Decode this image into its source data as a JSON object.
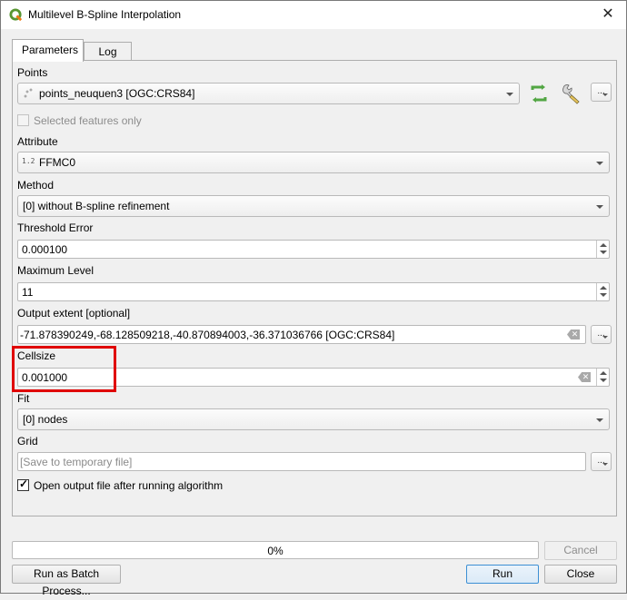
{
  "window": {
    "title": "Multilevel B-Spline Interpolation",
    "app_icon": "qgis-logo-icon",
    "close_icon": "close-icon"
  },
  "tabs": [
    {
      "label": "Parameters",
      "active": true
    },
    {
      "label": "Log",
      "active": false
    }
  ],
  "params": {
    "points": {
      "label": "Points",
      "value": "points_neuquen3 [OGC:CRS84]",
      "layer_icon": "point-layer-icon",
      "iterate_icon": "iterate-features-icon",
      "settings_icon": "wrench-icon",
      "browse_label": "..."
    },
    "selected_only": {
      "label": "Selected features only",
      "checked": false,
      "enabled": false
    },
    "attribute": {
      "label": "Attribute",
      "type_badge": "1.2",
      "value": "FFMC0"
    },
    "method": {
      "label": "Method",
      "value": "[0] without B-spline refinement"
    },
    "threshold": {
      "label": "Threshold Error",
      "value": "0.000100"
    },
    "max_level": {
      "label": "Maximum Level",
      "value": "11"
    },
    "extent": {
      "label": "Output extent [optional]",
      "value": "-71.878390249,-68.128509218,-40.870894003,-36.371036766 [OGC:CRS84]",
      "browse_label": "..."
    },
    "cellsize": {
      "label": "Cellsize",
      "value": "0.001000"
    },
    "fit": {
      "label": "Fit",
      "value": "[0] nodes"
    },
    "grid": {
      "label": "Grid",
      "placeholder": "[Save to temporary file]",
      "browse_label": "..."
    },
    "open_output": {
      "label": "Open output file after running algorithm",
      "checked": true
    }
  },
  "footer": {
    "progress_percent": 0,
    "progress_label": "0%",
    "cancel_label": "Cancel",
    "batch_label": "Run as Batch Process...",
    "run_label": "Run",
    "close_label": "Close"
  },
  "annotation": {
    "highlight_color": "#e00000",
    "highlighted_field": "Cellsize"
  }
}
